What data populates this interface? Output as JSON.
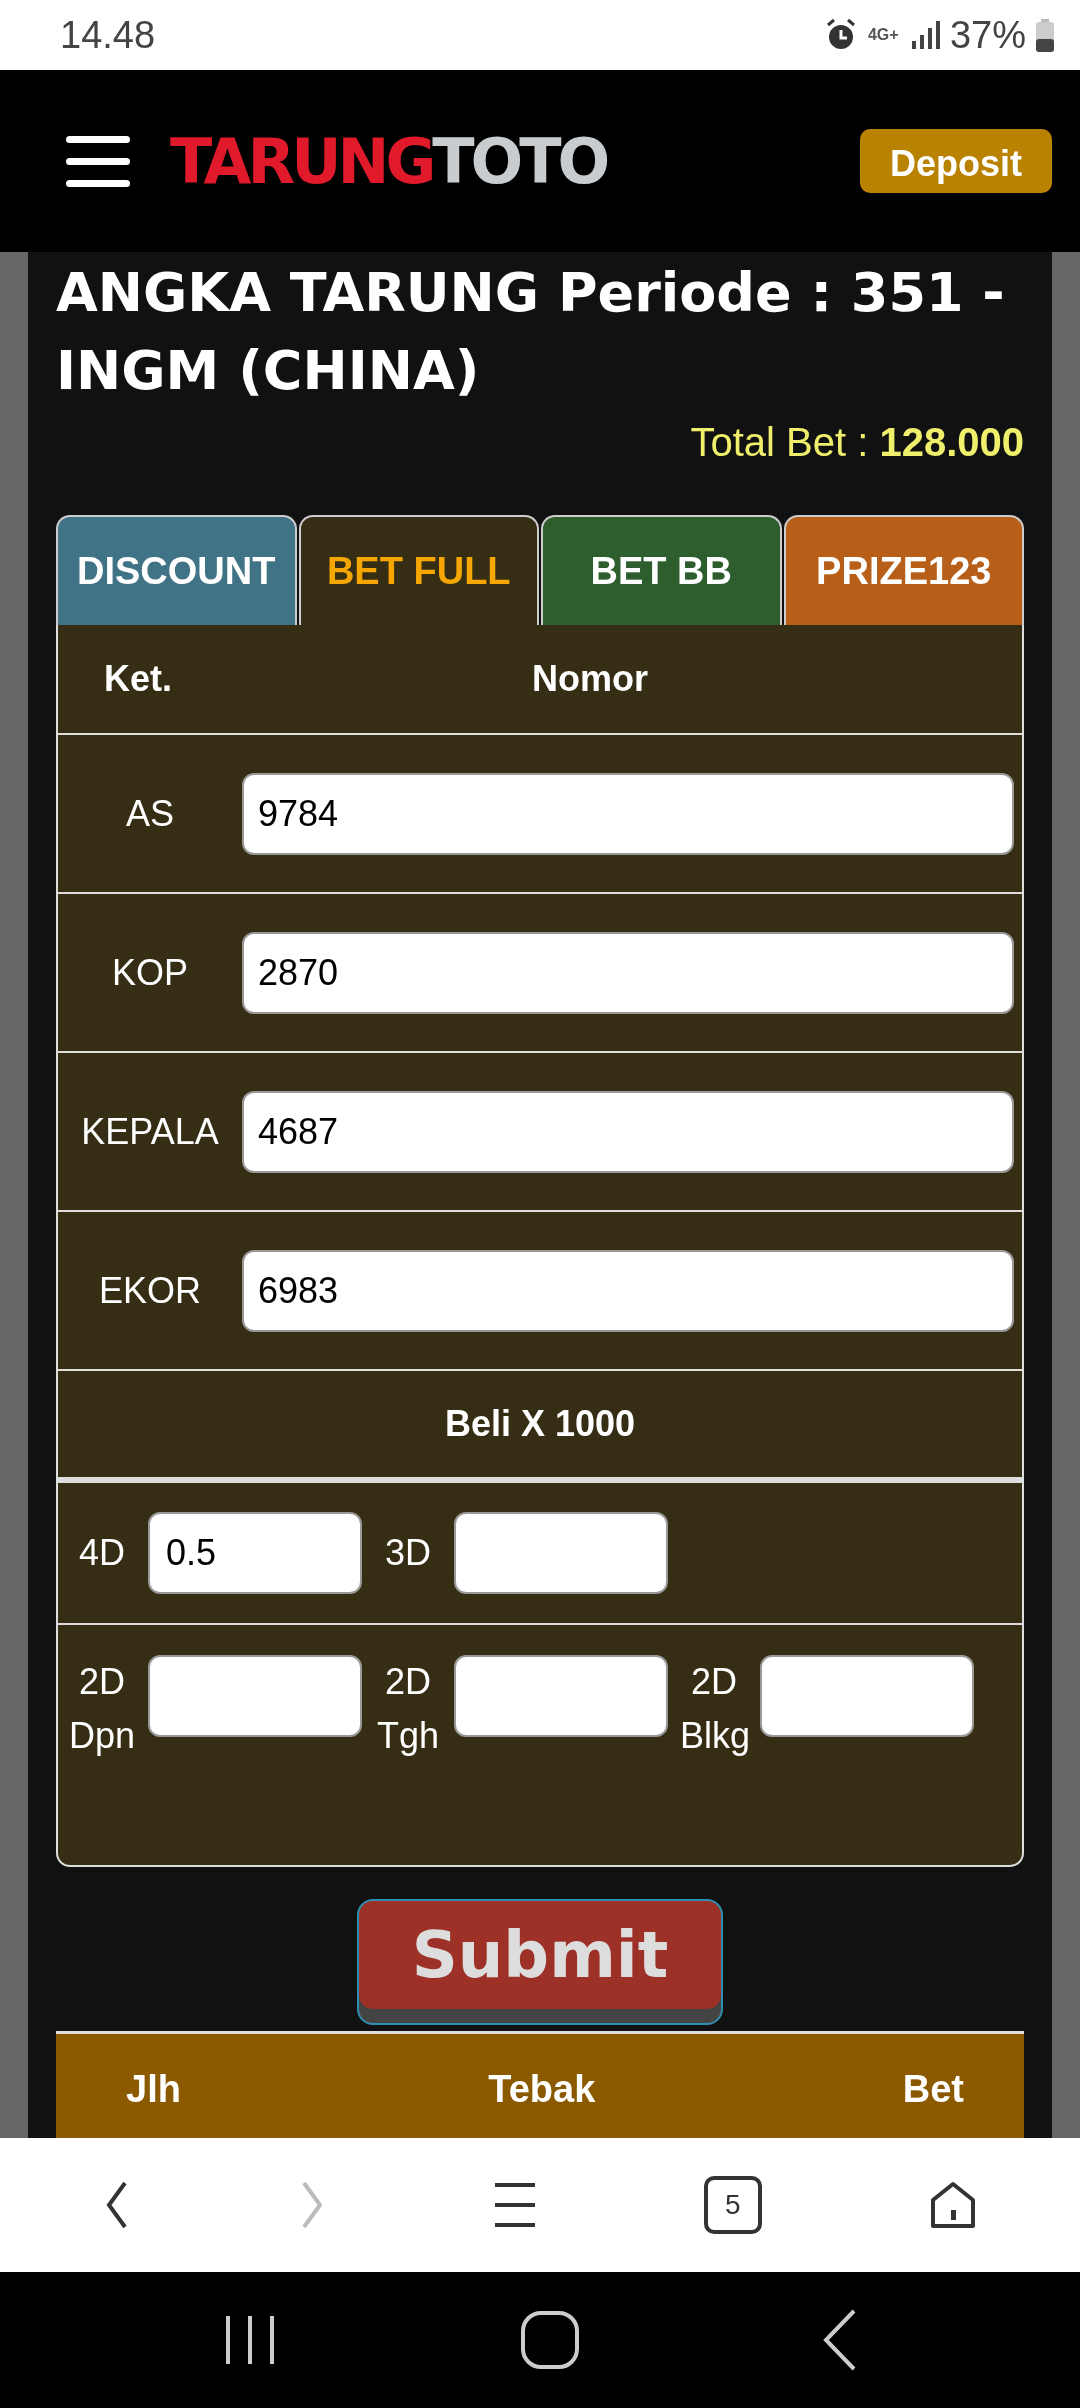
{
  "status_bar": {
    "time": "14.48",
    "network": "4G+",
    "battery": "37%"
  },
  "header": {
    "logo_parts": [
      "TARUNG",
      "TOTO"
    ],
    "deposit_button": "Deposit"
  },
  "title": "ANGKA TARUNG Periode : 351 - INGM (CHINA)",
  "total_bet": "Total Bet : **128.000**",
  "tabs": [
    {
      "label": "DISCOUNT",
      "selected": false,
      "color": "#417386"
    },
    {
      "label": "BET FULL",
      "selected": true,
      "color": "#352d14"
    },
    {
      "label": "BET BB",
      "selected": false,
      "color": "#2e5e2e"
    },
    {
      "label": "PRIZE123",
      "selected": false,
      "color": "#b75f18"
    }
  ],
  "bet_table": {
    "columns": [
      "Ket.",
      "Nomor"
    ],
    "rows": [
      {
        "label": "AS",
        "value": "9784"
      },
      {
        "label": "KOP",
        "value": "2870"
      },
      {
        "label": "KEPALA",
        "value": "4687"
      },
      {
        "label": "EKOR",
        "value": "6983"
      }
    ],
    "multiplier": "Beli X 1000",
    "amount_rows": [
      [
        {
          "label": "4D",
          "value": "0.5"
        },
        {
          "label": "3D"
        }
      ],
      [
        {
          "label": "2D Dpn"
        },
        {
          "label": "2D Tgh"
        },
        {
          "label": "2D Blkg"
        }
      ]
    ]
  },
  "submit_button": "Submit",
  "result_table": {
    "columns": [
      "Jlh",
      "Tebak",
      "Bet"
    ]
  },
  "browser_bar": {
    "tab_count": "5"
  }
}
